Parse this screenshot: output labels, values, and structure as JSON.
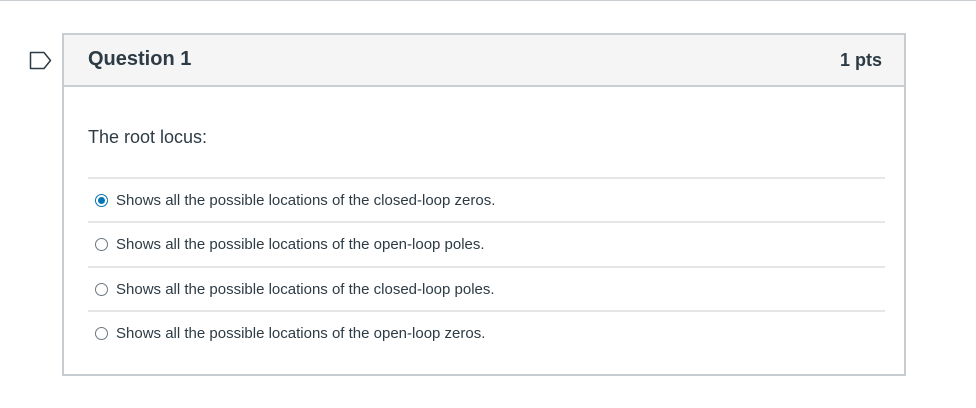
{
  "question": {
    "title": "Question 1",
    "points": "1 pts",
    "prompt": "The root locus:",
    "selected_index": 0,
    "answers": [
      {
        "label": "Shows all the possible locations of the closed-loop zeros.",
        "selected": true
      },
      {
        "label": "Shows all the possible locations of the open-loop poles.",
        "selected": false
      },
      {
        "label": "Shows all the possible locations of the closed-loop poles.",
        "selected": false
      },
      {
        "label": "Shows all the possible locations of the open-loop zeros.",
        "selected": false
      }
    ]
  },
  "icons": {
    "flag": "flag-icon"
  },
  "colors": {
    "accent": "#0374b5",
    "border": "#c7cdd1",
    "header_bg": "#f5f5f5",
    "text": "#2d3b45"
  }
}
